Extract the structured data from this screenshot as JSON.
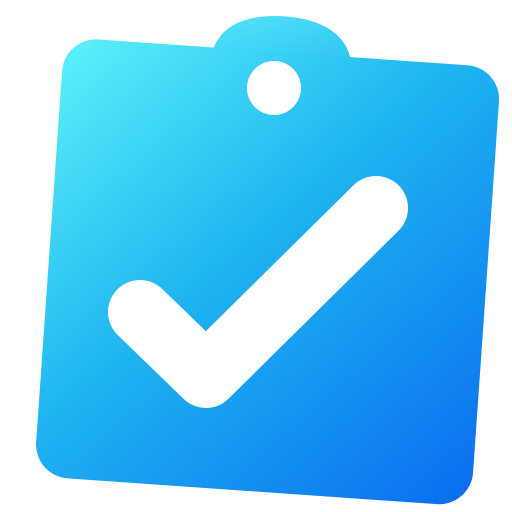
{
  "icon": {
    "name": "checklist-clipboard-app-icon",
    "colors": {
      "gradient_start": "#5CF2FA",
      "gradient_mid": "#1EB4F0",
      "gradient_end": "#0A6CF0",
      "checkmark": "#FFFFFF",
      "hole": "#FFFFFF",
      "background": "#FFFFFF"
    }
  }
}
